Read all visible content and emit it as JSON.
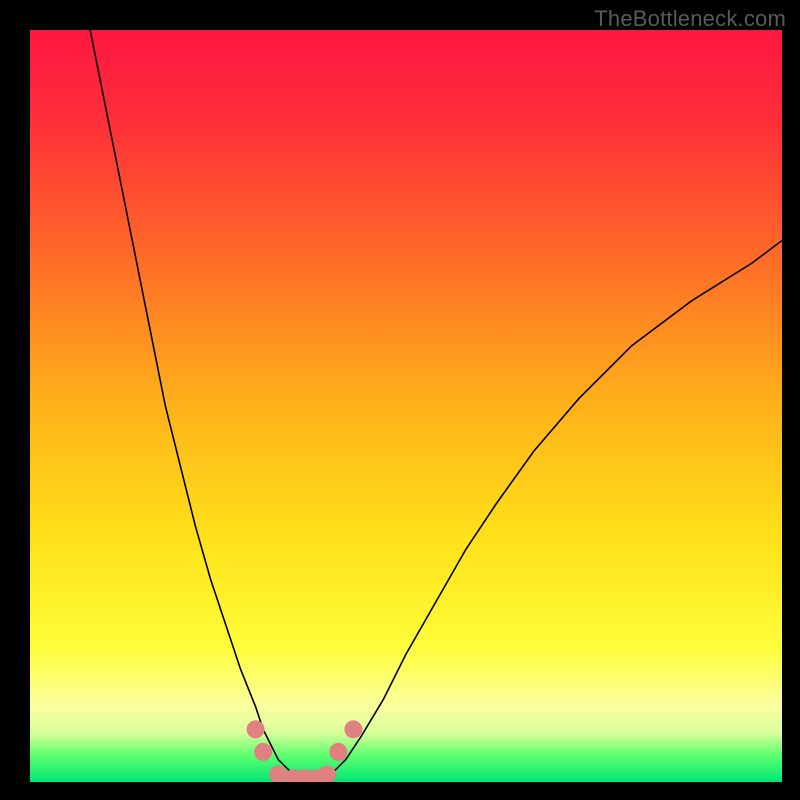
{
  "watermark": "TheBottleneck.com",
  "gradient": {
    "type": "vertical",
    "description": "red at top through orange and yellow to thin bright green band at bottom",
    "stops": [
      {
        "offset": 0.0,
        "color": "#ff1740"
      },
      {
        "offset": 0.12,
        "color": "#ff2e3a"
      },
      {
        "offset": 0.3,
        "color": "#ff6a28"
      },
      {
        "offset": 0.5,
        "color": "#ffb21a"
      },
      {
        "offset": 0.68,
        "color": "#ffe21a"
      },
      {
        "offset": 0.82,
        "color": "#fffd3a"
      },
      {
        "offset": 0.9,
        "color": "#faffa0"
      },
      {
        "offset": 0.935,
        "color": "#d8ff9a"
      },
      {
        "offset": 0.965,
        "color": "#5cff6e"
      },
      {
        "offset": 1.0,
        "color": "#00e676"
      }
    ]
  },
  "chart_data": {
    "type": "line",
    "title": "",
    "xlabel": "",
    "ylabel": "",
    "xlim": [
      0,
      100
    ],
    "ylim": [
      0,
      100
    ],
    "grid": false,
    "series": [
      {
        "name": "curve-left",
        "stroke": "#000000",
        "stroke_width": 1.6,
        "x": [
          8,
          10,
          12,
          14,
          16,
          18,
          20,
          22,
          24,
          26,
          28,
          30,
          31,
          32,
          33,
          34,
          35
        ],
        "y": [
          100,
          90,
          80,
          70,
          60,
          50,
          42,
          34,
          27,
          21,
          15,
          10,
          7,
          5,
          3,
          2,
          1
        ]
      },
      {
        "name": "curve-right",
        "stroke": "#000000",
        "stroke_width": 1.6,
        "x": [
          40,
          42,
          44,
          47,
          50,
          54,
          58,
          62,
          67,
          73,
          80,
          88,
          96,
          100
        ],
        "y": [
          1,
          3,
          6,
          11,
          17,
          24,
          31,
          37,
          44,
          51,
          58,
          64,
          69,
          72
        ]
      },
      {
        "name": "bottom-markers",
        "type": "scatter",
        "marker_color": "#e08080",
        "marker_size": 9,
        "x": [
          30,
          31,
          33,
          35,
          36.5,
          38,
          39.5,
          41,
          43
        ],
        "y": [
          7,
          4,
          1,
          0.5,
          0.5,
          0.5,
          1,
          4,
          7
        ]
      }
    ]
  }
}
